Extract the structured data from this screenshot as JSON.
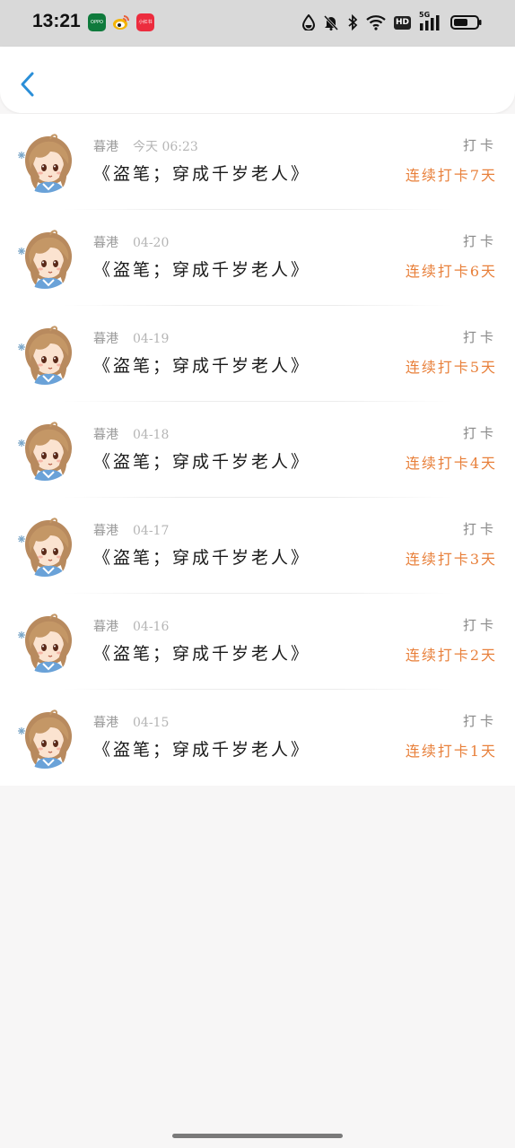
{
  "status_bar": {
    "time": "13:21",
    "apps": [
      {
        "name": "oppo-app-icon",
        "label": "OPPO",
        "color": "#0f7a3c"
      },
      {
        "name": "weibo-app-icon",
        "label": "",
        "color": "#f4b400"
      },
      {
        "name": "xiaohongshu-app-icon",
        "label": "小红书",
        "color": "#ec2c3e"
      }
    ],
    "hd_label": "HD",
    "network_label": "5G"
  },
  "nav": {
    "back_icon": "chevron-left-icon",
    "accent_color": "#2b8fd8"
  },
  "checkins": [
    {
      "author": "暮港",
      "date": "今天 06:23",
      "book": "《盗笔；穿成千岁老人》",
      "label": "打卡",
      "streak": "连续打卡7天"
    },
    {
      "author": "暮港",
      "date": "04-20",
      "book": "《盗笔；穿成千岁老人》",
      "label": "打卡",
      "streak": "连续打卡6天"
    },
    {
      "author": "暮港",
      "date": "04-19",
      "book": "《盗笔；穿成千岁老人》",
      "label": "打卡",
      "streak": "连续打卡5天"
    },
    {
      "author": "暮港",
      "date": "04-18",
      "book": "《盗笔；穿成千岁老人》",
      "label": "打卡",
      "streak": "连续打卡4天"
    },
    {
      "author": "暮港",
      "date": "04-17",
      "book": "《盗笔；穿成千岁老人》",
      "label": "打卡",
      "streak": "连续打卡3天"
    },
    {
      "author": "暮港",
      "date": "04-16",
      "book": "《盗笔；穿成千岁老人》",
      "label": "打卡",
      "streak": "连续打卡2天"
    },
    {
      "author": "暮港",
      "date": "04-15",
      "book": "《盗笔；穿成千岁老人》",
      "label": "打卡",
      "streak": "连续打卡1天"
    }
  ],
  "colors": {
    "streak": "#e8803b",
    "background": "#f7f6f6"
  }
}
